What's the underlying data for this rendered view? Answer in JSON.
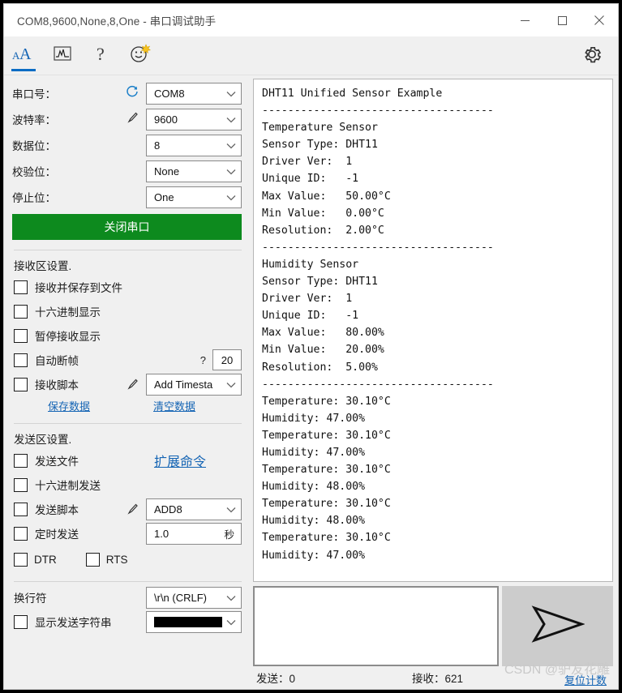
{
  "window": {
    "title": "COM8,9600,None,8,One - 串口调试助手",
    "minimize_label": "minimize",
    "maximize_label": "maximize",
    "close_label": "close"
  },
  "toolbar": {
    "items": [
      {
        "name": "font-icon",
        "label": "aA"
      },
      {
        "name": "waveform-icon",
        "label": "waveform"
      },
      {
        "name": "help-icon",
        "label": "?"
      },
      {
        "name": "smiley-icon",
        "label": "smiley"
      }
    ],
    "settings_label": "settings"
  },
  "serial": {
    "rows": [
      {
        "label": "串口号：",
        "value": "COM8",
        "icon": "refresh-icon"
      },
      {
        "label": "波特率：",
        "value": "9600",
        "icon": "pen-icon"
      },
      {
        "label": "数据位：",
        "value": "8",
        "icon": ""
      },
      {
        "label": "校验位：",
        "value": "None",
        "icon": ""
      },
      {
        "label": "停止位：",
        "value": "One",
        "icon": ""
      }
    ],
    "open_button": "关闭串口",
    "open_button_color": "#0d8a1e"
  },
  "receive": {
    "section_title": "接收区设置.",
    "checks": [
      {
        "label": "接收并保存到文件",
        "checked": false
      },
      {
        "label": "十六进制显示",
        "checked": false
      },
      {
        "label": "暂停接收显示",
        "checked": false
      },
      {
        "label": "自动断帧",
        "checked": false
      },
      {
        "label": "接收脚本",
        "checked": false
      }
    ],
    "auto_frame_hint": "?",
    "auto_frame_value": "20",
    "script_value": "Add Timesta",
    "save_link": "保存数据",
    "clear_link": "清空数据"
  },
  "send": {
    "section_title": "发送区设置.",
    "checks": [
      {
        "label": "发送文件",
        "checked": false
      },
      {
        "label": "十六进制发送",
        "checked": false
      },
      {
        "label": "发送脚本",
        "checked": false
      },
      {
        "label": "定时发送",
        "checked": false
      }
    ],
    "extend_link": "扩展命令",
    "script_value": "ADD8",
    "interval_value": "1.0",
    "interval_unit": "秒",
    "dtr_label": "DTR",
    "rts_label": "RTS"
  },
  "footer": {
    "newline_label": "换行符",
    "newline_value": "\\r\\n (CRLF)",
    "show_string_label": "显示发送字符串",
    "color_value": "#000000"
  },
  "terminal": {
    "text": "DHT11 Unified Sensor Example\n------------------------------------\nTemperature Sensor\nSensor Type: DHT11\nDriver Ver:  1\nUnique ID:   -1\nMax Value:   50.00°C\nMin Value:   0.00°C\nResolution:  2.00°C\n------------------------------------\nHumidity Sensor\nSensor Type: DHT11\nDriver Ver:  1\nUnique ID:   -1\nMax Value:   80.00%\nMin Value:   20.00%\nResolution:  5.00%\n------------------------------------\nTemperature: 30.10°C\nHumidity: 47.00%\nTemperature: 30.10°C\nHumidity: 47.00%\nTemperature: 30.10°C\nHumidity: 48.00%\nTemperature: 30.10°C\nHumidity: 48.00%\nTemperature: 30.10°C\nHumidity: 47.00%"
  },
  "compose": {
    "input_value": "",
    "send_button_label": "send-arrow"
  },
  "status": {
    "sent": "发送：0",
    "received": "接收：621",
    "watermark": "CSDN @驴友花雕",
    "watermark_link": "复位计数"
  }
}
